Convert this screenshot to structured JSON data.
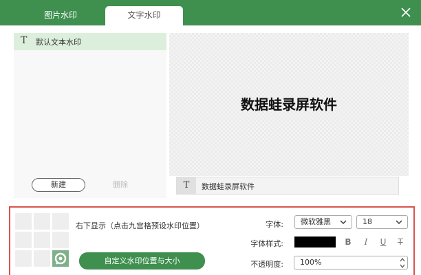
{
  "tabs": {
    "image_watermark": "图片水印",
    "text_watermark": "文字水印"
  },
  "left_panel": {
    "items": [
      {
        "label": "默认文本水印"
      }
    ],
    "new_label": "新建",
    "delete_label": "删除"
  },
  "preview": {
    "text": "数据蛙录屏软件"
  },
  "text_input": {
    "value": "数据蛙录屏软件"
  },
  "position": {
    "text": "右下显示（点击九宫格预设水印位置）",
    "custom_button": "自定义水印位置与大小",
    "selected_cell": 8
  },
  "font": {
    "font_label": "字体:",
    "font_family": "微软雅黑",
    "font_size": "18",
    "style_label": "字体样式:",
    "color": "#000000",
    "bold": "B",
    "italic": "I",
    "underline": "U",
    "strike": "T",
    "opacity_label": "不透明度:",
    "opacity": "100%"
  },
  "colors": {
    "accent": "#3f8f4f",
    "highlight_border": "#d9534f",
    "selected_item_bg": "#dcefdc"
  }
}
